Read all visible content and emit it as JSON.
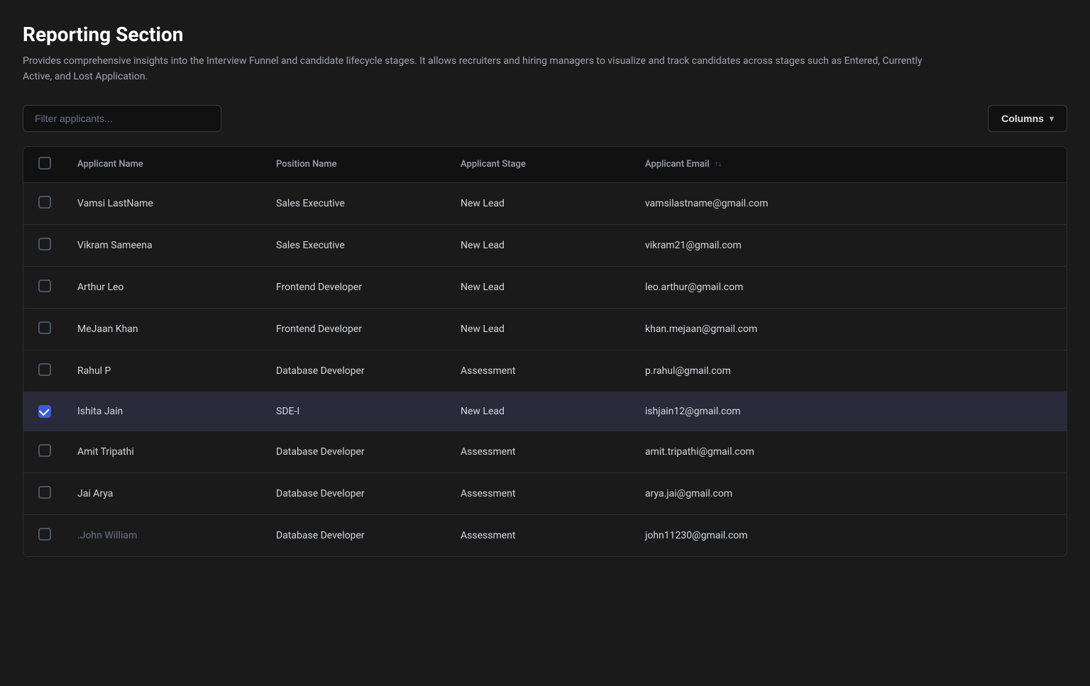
{
  "header": {
    "title": "Reporting Section",
    "description": "Provides comprehensive insights into the Interview Funnel and candidate lifecycle stages. It allows recruiters and hiring managers to visualize and track candidates across stages such as Entered, Currently Active, and Lost Application."
  },
  "toolbar": {
    "filter_placeholder": "Filter applicants...",
    "columns_button_label": "Columns"
  },
  "table": {
    "columns": [
      {
        "id": "checkbox",
        "label": ""
      },
      {
        "id": "name",
        "label": "Applicant Name"
      },
      {
        "id": "position",
        "label": "Position Name"
      },
      {
        "id": "stage",
        "label": "Applicant Stage"
      },
      {
        "id": "email",
        "label": "Applicant Email",
        "sortable": true
      }
    ],
    "rows": [
      {
        "id": 1,
        "name": "Vamsi LastName",
        "position": "Sales Executive",
        "stage": "New Lead",
        "email": "vamsilastname@gmail.com",
        "selected": false
      },
      {
        "id": 2,
        "name": "Vikram Sameena",
        "position": "Sales Executive",
        "stage": "New Lead",
        "email": "vikram21@gmail.com",
        "selected": false
      },
      {
        "id": 3,
        "name": "Arthur Leo",
        "position": "Frontend Developer",
        "stage": "New Lead",
        "email": "leo.arthur@gmail.com",
        "selected": false
      },
      {
        "id": 4,
        "name": "MeJaan Khan",
        "position": "Frontend Developer",
        "stage": "New Lead",
        "email": "khan.mejaan@gmail.com",
        "selected": false
      },
      {
        "id": 5,
        "name": "Rahul P",
        "position": "Database Developer",
        "stage": "Assessment",
        "email": "p.rahul@gmail.com",
        "selected": false
      },
      {
        "id": 6,
        "name": "Ishita Jain",
        "position": "SDE-I",
        "stage": "New Lead",
        "email": "ishjain12@gmail.com",
        "selected": true
      },
      {
        "id": 7,
        "name": "Amit Tripathi",
        "position": "Database Developer",
        "stage": "Assessment",
        "email": "amit.tripathi@gmail.com",
        "selected": false
      },
      {
        "id": 8,
        "name": "Jai Arya",
        "position": "Database Developer",
        "stage": "Assessment",
        "email": "arya.jai@gmail.com",
        "selected": false
      },
      {
        "id": 9,
        "name": "John William",
        "position": "Database Developer",
        "stage": "Assessment",
        "email": "john11230@gmail.com",
        "selected": false
      }
    ]
  }
}
